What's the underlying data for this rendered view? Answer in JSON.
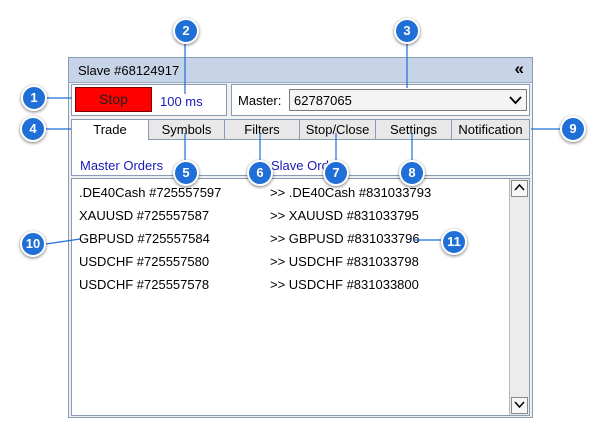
{
  "window": {
    "title": "Slave #68124917",
    "collapse_icon": "double-chevron-left-icon"
  },
  "stop": {
    "label": "Stop",
    "color": "#ff0000",
    "delay": "100 ms"
  },
  "master": {
    "label": "Master:",
    "value": "62787065"
  },
  "tabs": [
    {
      "label": "Trade",
      "active": true
    },
    {
      "label": "Symbols",
      "active": false
    },
    {
      "label": "Filters",
      "active": false
    },
    {
      "label": "Stop/Close",
      "active": false
    },
    {
      "label": "Settings",
      "active": false
    },
    {
      "label": "Notification",
      "active": false
    }
  ],
  "columns": {
    "master": "Master Orders",
    "slave": "Slave Ord"
  },
  "orders": [
    {
      "master": ".DE40Cash #725557597",
      "slave": ">> .DE40Cash #831033793"
    },
    {
      "master": "XAUUSD #725557587",
      "slave": ">> XAUUSD #831033795"
    },
    {
      "master": "GBPUSD #725557584",
      "slave": ">> GBPUSD #831033796"
    },
    {
      "master": "USDCHF #725557580",
      "slave": ">> USDCHF #831033798"
    },
    {
      "master": "USDCHF #725557578",
      "slave": ">> USDCHF #831033800"
    }
  ],
  "callouts": [
    "1",
    "2",
    "3",
    "4",
    "5",
    "6",
    "7",
    "8",
    "9",
    "10",
    "11"
  ],
  "colors": {
    "callout": "#1f6fd6",
    "link_text": "#1a1ab8",
    "titlebar": "#c7d3e6"
  }
}
